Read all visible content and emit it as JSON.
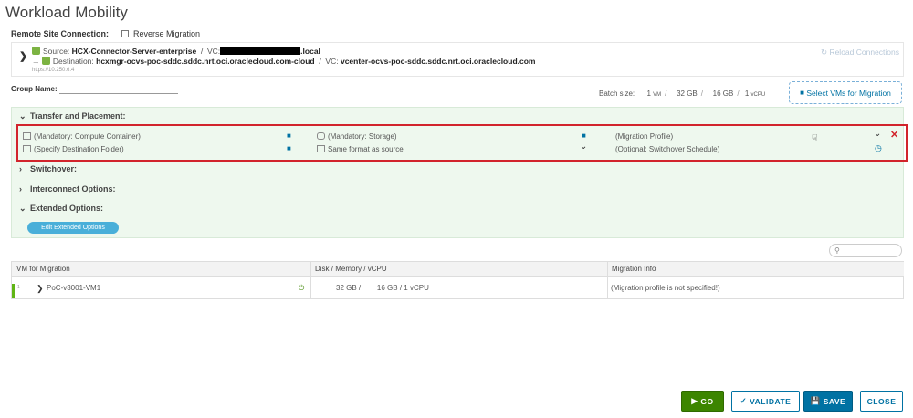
{
  "title": "Workload Mobility",
  "remote": {
    "label": "Remote Site Connection:",
    "reverse_label": "Reverse Migration",
    "source_prefix": "Source:",
    "source_name": "HCX-Connector-Server-enterprise",
    "vc_label": "VC:",
    "source_vc_suffix": ".local",
    "dest_prefix": "Destination:",
    "dest_name": "hcxmgr-ocvs-poc-sddc.sddc.nrt.oci.oraclecloud.com-cloud",
    "dest_vc": "vcenter-ocvs-poc-sddc.sddc.nrt.oci.oraclecloud.com",
    "ip": "https://10.250.6.4",
    "reload": "Reload Connections"
  },
  "group": {
    "label": "Group Name:",
    "value": ""
  },
  "batch": {
    "label": "Batch size:",
    "vm_count": "1",
    "vm_unit": "VM",
    "storage": "32 GB",
    "memory": "16 GB",
    "vcpu_count": "1",
    "vcpu_unit": "vCPU"
  },
  "select_vms": "Select VMs for Migration",
  "sections": {
    "transfer": "Transfer and Placement:",
    "switchover": "Switchover:",
    "interconnect": "Interconnect Options:",
    "extended": "Extended Options:"
  },
  "placement": {
    "compute": "(Mandatory: Compute Container)",
    "storage": "(Mandatory: Storage)",
    "profile": "(Migration Profile)",
    "folder": "(Specify Destination Folder)",
    "format": "Same format as source",
    "schedule": "(Optional: Switchover Schedule)"
  },
  "edit_extended": "Edit Extended Options",
  "table": {
    "headers": [
      "VM for Migration",
      "Disk / Memory / vCPU",
      "Migration Info"
    ],
    "row": {
      "index": "1",
      "name": "PoC-v3001-VM1",
      "disk": "32 GB",
      "memory": "16 GB",
      "vcpu": "1 vCPU",
      "info": "(Migration profile is not specified!)"
    }
  },
  "buttons": {
    "go": "GO",
    "validate": "VALIDATE",
    "save": "SAVE",
    "close": "CLOSE"
  },
  "colors": {
    "accent": "#0072a3",
    "go": "#3c8500",
    "highlight": "#d2242c",
    "panel": "#eef8ee"
  }
}
